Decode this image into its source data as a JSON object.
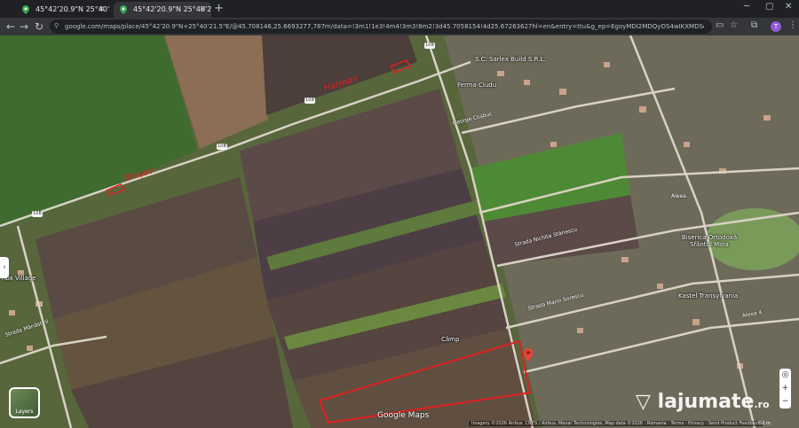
{
  "browser": {
    "tabs": [
      {
        "title": "45°42'20.9\"N 25°40'21.5\"E - Go",
        "active": false
      },
      {
        "title": "45°42'20.9\"N 25°40'21.5\"E - Go",
        "active": true
      }
    ],
    "new_tab": "+",
    "url": "google.com/maps/place/45°42'20.9\"N+25°40'21.5\"E/@45.708146,25.6693277,787m/data=!3m1!1e3!4m4!3m3!8m2!3d45.7058154!4d25.67263627hl=en&entry=ttu&g_ep=EgoyMDI2MDQyOS4wIKXMDSoASAFQAw%3D%3D",
    "profile_initial": "T"
  },
  "map": {
    "pois": [
      {
        "label": "S.C. Sarlex Build S.R.L."
      },
      {
        "label": "Ferma Ciudu"
      },
      {
        "label": "Rox Village"
      },
      {
        "label": "Câmp"
      },
      {
        "label": "Biserica Ortodoxă Sfântul Mina"
      },
      {
        "label": "Kastel Transylvania"
      }
    ],
    "streets": [
      {
        "label": "George Coșbuc"
      },
      {
        "label": "Strada Nichita Stănescu"
      },
      {
        "label": "Strada Marin Sorescu"
      },
      {
        "label": "Strada Mânăstirii"
      },
      {
        "label": "Aleea"
      },
      {
        "label": "Aleea 4"
      }
    ],
    "road_shields": [
      "10B",
      "10B",
      "10B",
      "10B"
    ],
    "layers_label": "Layers",
    "brand": "Google Maps",
    "attribution": "Imagery ©2026 Airbus, CNES / Airbus, Maxar Technologies, Map data ©2026 · Romania · Terms · Privacy · Send Product Feedback",
    "scale": "50 m",
    "annotation_color": "#e02020"
  },
  "watermark": {
    "brand": "lajumate",
    "tld": ".ro"
  }
}
